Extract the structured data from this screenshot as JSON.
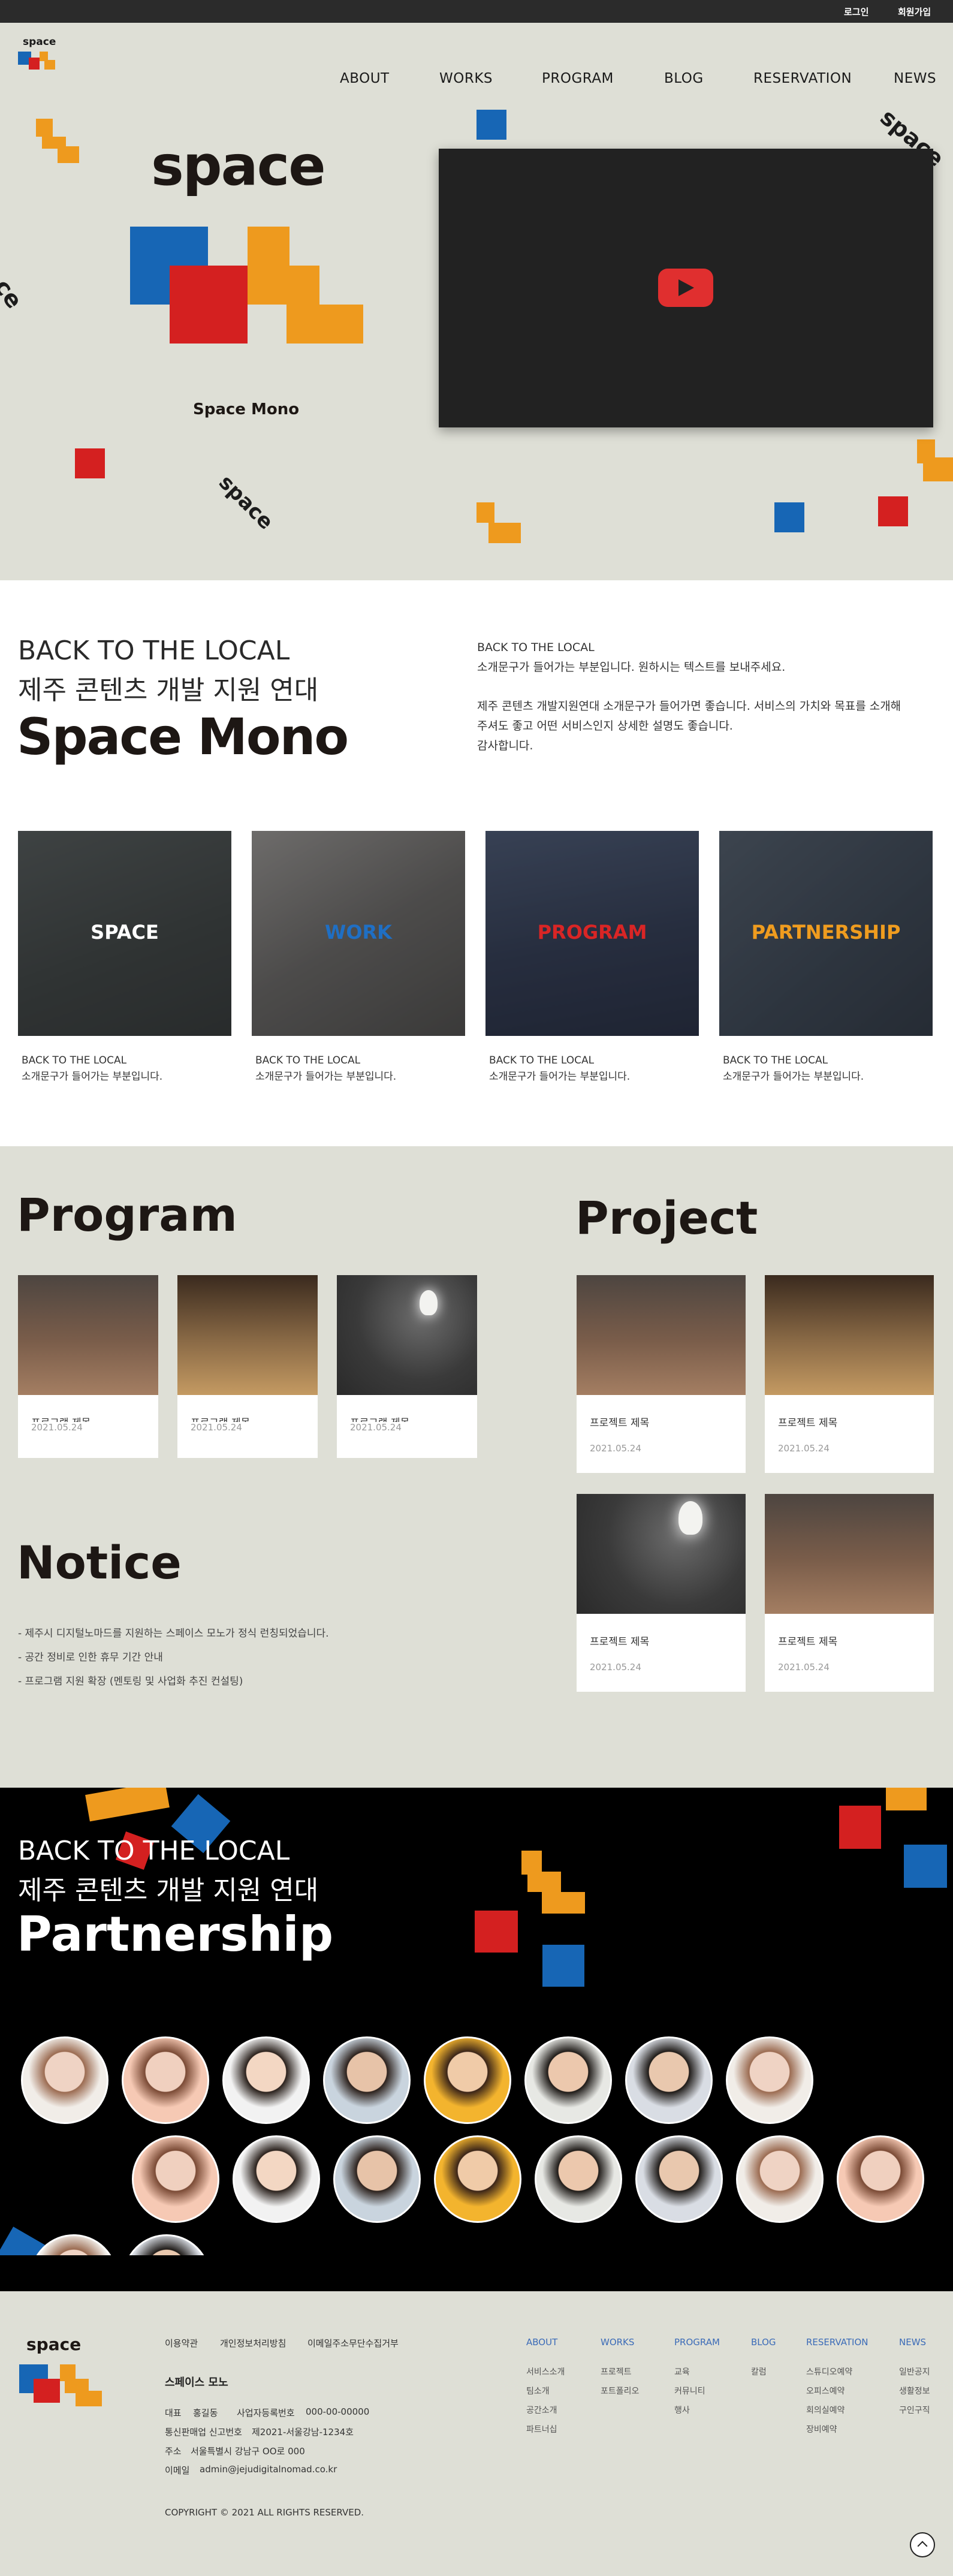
{
  "topbar": {
    "login": "로그인",
    "signup": "회원가입"
  },
  "logo": {
    "text": "space"
  },
  "nav": [
    "ABOUT",
    "WORKS",
    "PROGRAM",
    "BLOG",
    "RESERVATION",
    "NEWS"
  ],
  "hero": {
    "logo_big": "space",
    "sub_brand": "Space Mono",
    "rot_top_right": "space",
    "rot_left": "ce",
    "rot_bottom": "space"
  },
  "intro": {
    "line1": "BACK TO THE LOCAL",
    "line2": "제주 콘텐츠 개발 지원 연대",
    "title": "Space Mono",
    "p1": "BACK TO THE LOCAL",
    "p2": "소개문구가 들어가는 부분입니다. 원하시는 텍스트를 보내주세요.",
    "p3": "제주 콘텐츠 개발지원연대 소개문구가 들어가면 좋습니다. 서비스의 가치와 목표를 소개해",
    "p4": "주셔도 좋고 어떤 서비스인지 상세한 설명도 좋습니다.",
    "p5": "감사합니다."
  },
  "categories": [
    {
      "label": "SPACE",
      "color": "#ffffff",
      "cap1": "BACK TO THE LOCAL",
      "cap2": "소개문구가 들어가는 부분입니다."
    },
    {
      "label": "WORK",
      "color": "#1f6fc4",
      "cap1": "BACK TO THE LOCAL",
      "cap2": "소개문구가 들어가는 부분입니다."
    },
    {
      "label": "PROGRAM",
      "color": "#d92525",
      "cap1": "BACK TO THE LOCAL",
      "cap2": "소개문구가 들어가는 부분입니다."
    },
    {
      "label": "PARTNERSHIP",
      "color": "#ef9c1f",
      "cap1": "BACK TO THE LOCAL",
      "cap2": "소개문구가 들어가는 부분입니다."
    }
  ],
  "program": {
    "title": "Program",
    "items": [
      {
        "title": "프로그램 제목",
        "date": "2021.05.24"
      },
      {
        "title": "프로그램 제목",
        "date": "2021.05.24"
      },
      {
        "title": "프로그램 제목",
        "date": "2021.05.24"
      }
    ]
  },
  "project": {
    "title": "Project",
    "items": [
      {
        "title": "프로젝트 제목",
        "date": "2021.05.24"
      },
      {
        "title": "프로젝트 제목",
        "date": "2021.05.24"
      },
      {
        "title": "프로젝트 제목",
        "date": "2021.05.24"
      },
      {
        "title": "프로젝트 제목",
        "date": "2021.05.24"
      }
    ]
  },
  "notice": {
    "title": "Notice",
    "items": [
      "- 제주시 디지털노마드를 지원하는 스페이스 모노가 정식 런칭되었습니다.",
      "- 공간 정비로 인한 휴무 기간 안내",
      "- 프로그램 지원 확장 (멘토링 및 사업화 추진 컨설팅)"
    ]
  },
  "partnership": {
    "line1": "BACK TO THE LOCAL",
    "line2": "제주 콘텐츠 개발 지원 연대",
    "title": "Partnership"
  },
  "footer": {
    "logo": "space",
    "links": [
      "이용약관",
      "개인정보처리방침",
      "이메일주소무단수집거부"
    ],
    "company": "스페이스 모노",
    "rep_label": "대표",
    "rep": "홍길동",
    "biz_label": "사업자등록번호",
    "biz": "000-00-00000",
    "comm_label": "통신판매업 신고번호",
    "comm": "제2021-서울강남-1234호",
    "addr_label": "주소",
    "addr": "서울특별시 강남구 OO로 000",
    "email_label": "이메일",
    "email": "admin@jejudigitalnomad.co.kr",
    "copyright": "COPYRIGHT © 2021 ALL RIGHTS RESERVED.",
    "cols": [
      {
        "head": "ABOUT",
        "items": [
          "서비스소개",
          "팀소개",
          "공간소개",
          "파트너십"
        ]
      },
      {
        "head": "WORKS",
        "items": [
          "프로젝트",
          "포트폴리오"
        ]
      },
      {
        "head": "PROGRAM",
        "items": [
          "교육",
          "커뮤니티",
          "행사"
        ]
      },
      {
        "head": "BLOG",
        "items": [
          "칼럼"
        ]
      },
      {
        "head": "RESERVATION",
        "items": [
          "스튜디오예약",
          "오피스예약",
          "회의실예약",
          "장비예약"
        ]
      },
      {
        "head": "NEWS",
        "items": [
          "일반공지",
          "생활정보",
          "구인구직"
        ]
      }
    ]
  },
  "colors": {
    "blue": "#1766b5",
    "red": "#d42020",
    "yellow": "#ee9a1e",
    "bg": "#dedfd6",
    "link": "#3b6bb8"
  }
}
